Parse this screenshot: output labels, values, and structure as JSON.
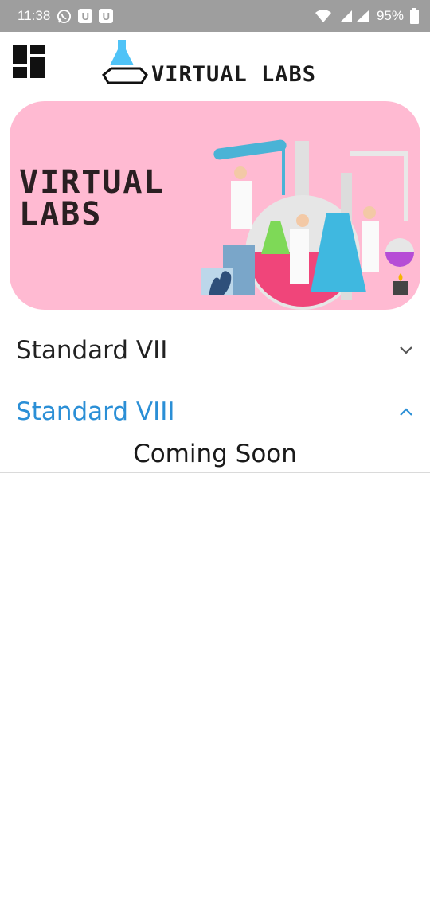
{
  "status_bar": {
    "time": "11:38",
    "battery": "95%",
    "notif_badges": [
      "U",
      "U"
    ],
    "icons": [
      "whatsapp-icon",
      "wifi-icon",
      "signal-icon",
      "battery-icon"
    ]
  },
  "header": {
    "menu_icon": "dashboard-grid-icon",
    "logo_text": "VIRTUAL LABS"
  },
  "banner": {
    "title_line1": "VIRTUAL",
    "title_line2": "LABS",
    "background": "#ffbad2"
  },
  "accordion": {
    "items": [
      {
        "label": "Standard VII",
        "expanded": false
      },
      {
        "label": "Standard VIII",
        "expanded": true,
        "content": "Coming Soon"
      }
    ],
    "active_color": "#2b8fd6"
  }
}
